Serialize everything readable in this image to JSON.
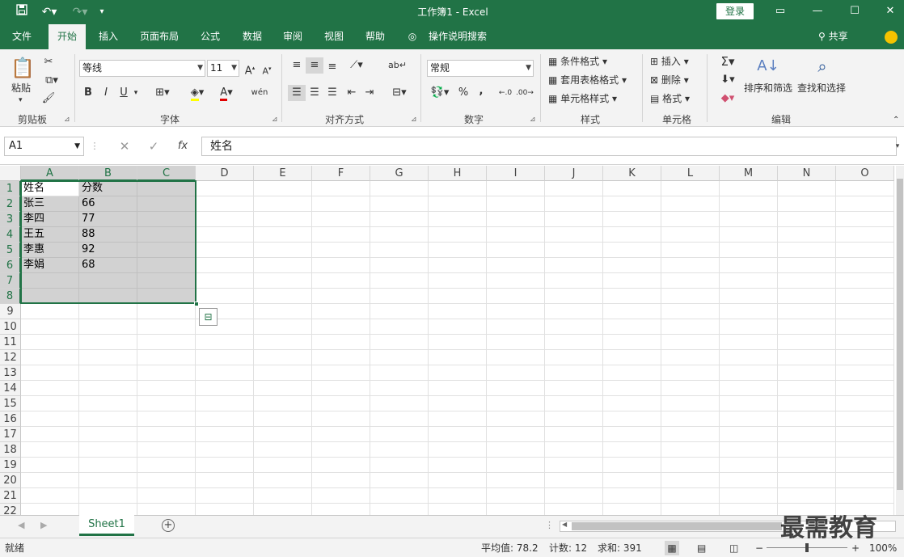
{
  "title_bar": {
    "title": "工作簿1  -  Excel",
    "login_label": "登录",
    "qat": {
      "save_icon": "save-icon",
      "undo_icon": "undo-icon",
      "redo_icon": "redo-icon"
    }
  },
  "tabs": [
    {
      "label": "文件",
      "active": false
    },
    {
      "label": "开始",
      "active": true
    },
    {
      "label": "插入",
      "active": false
    },
    {
      "label": "页面布局",
      "active": false
    },
    {
      "label": "公式",
      "active": false
    },
    {
      "label": "数据",
      "active": false
    },
    {
      "label": "审阅",
      "active": false
    },
    {
      "label": "视图",
      "active": false
    },
    {
      "label": "帮助",
      "active": false
    }
  ],
  "tell_me": "操作说明搜索",
  "share_label": "共享",
  "ribbon": {
    "clipboard": {
      "label": "剪贴板",
      "paste": "粘贴"
    },
    "font": {
      "label": "字体",
      "font_name": "等线",
      "font_size": "11",
      "bold": "B",
      "italic": "I",
      "underline": "U",
      "wen": "wén"
    },
    "alignment": {
      "label": "对齐方式"
    },
    "number": {
      "label": "数字",
      "format": "常规",
      "percent": "%",
      "comma": ","
    },
    "styles": {
      "label": "样式",
      "conditional": "条件格式",
      "table_format": "套用表格格式",
      "cell_styles": "单元格样式"
    },
    "cells": {
      "label": "单元格",
      "insert": "插入",
      "delete": "删除",
      "format": "格式"
    },
    "editing": {
      "label": "编辑",
      "sort_filter": "排序和筛选",
      "find_select": "查找和选择"
    }
  },
  "formula_bar": {
    "name_box": "A1",
    "fx": "fx",
    "value": "姓名"
  },
  "columns": [
    "A",
    "B",
    "C",
    "D",
    "E",
    "F",
    "G",
    "H",
    "I",
    "J",
    "K",
    "L",
    "M",
    "N",
    "O"
  ],
  "selected_columns": [
    "A",
    "B",
    "C"
  ],
  "rows": [
    "1",
    "2",
    "3",
    "4",
    "5",
    "6",
    "7",
    "8",
    "9",
    "10",
    "11",
    "12",
    "13",
    "14",
    "15",
    "16",
    "17",
    "18",
    "19",
    "20",
    "21",
    "22"
  ],
  "selected_rows": 8,
  "cells": [
    [
      "姓名",
      "分数"
    ],
    [
      "张三",
      "66"
    ],
    [
      "李四",
      "77"
    ],
    [
      "王五",
      "88"
    ],
    [
      "李惠",
      "92"
    ],
    [
      "李娟",
      "68"
    ]
  ],
  "sheet_tabs": [
    {
      "label": "Sheet1",
      "active": true
    }
  ],
  "status_bar": {
    "mode": "就绪",
    "average": "平均值: 78.2",
    "count": "计数: 12",
    "sum": "求和: 391",
    "zoom": "100%"
  },
  "watermark": "最需教育",
  "colors": {
    "accent": "#217346",
    "selection_fill": "#d2d2d2"
  }
}
